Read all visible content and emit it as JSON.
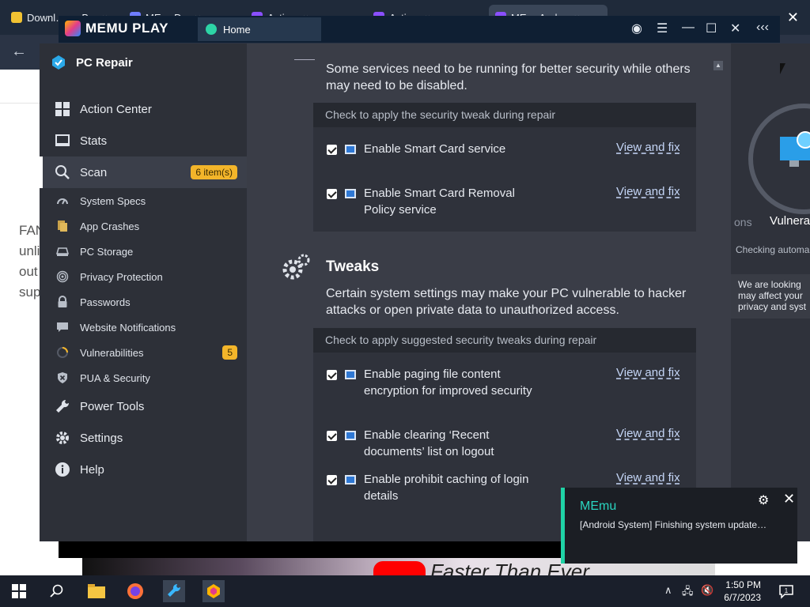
{
  "browser": {
    "tabs": [
      {
        "label": "Downl… — B… ×",
        "color": "#f1c232"
      },
      {
        "label": "ME… D… ×",
        "color": "#6f7dff"
      },
      {
        "label": "Activ… ×",
        "color": "#8a4fff"
      },
      {
        "label": "Activ… ×",
        "color": "#8a4fff"
      },
      {
        "label": "ME… Andr… ×",
        "color": "#8a4fff"
      }
    ],
    "page_lines": [
      "FAN",
      "unli",
      "out",
      "sup"
    ],
    "video_text": "Faster Than Ever"
  },
  "memu": {
    "title": "MEMU PLAY",
    "home_tab": "Home",
    "controls": [
      "person-icon",
      "menu-icon",
      "minimize-icon",
      "maximize-icon",
      "close-icon",
      "collapse-icon"
    ]
  },
  "app": {
    "name": "PC Repair",
    "nav": [
      {
        "label": "Action Center",
        "icon": "action-center-icon"
      },
      {
        "label": "Stats",
        "icon": "stats-icon"
      },
      {
        "label": "Scan",
        "icon": "scan-icon",
        "badge": "6 item(s)"
      }
    ],
    "sub": [
      {
        "label": "System Specs",
        "icon": "system-specs-icon"
      },
      {
        "label": "App Crashes",
        "icon": "app-crashes-icon"
      },
      {
        "label": "PC Storage",
        "icon": "pc-storage-icon"
      },
      {
        "label": "Privacy Protection",
        "icon": "privacy-icon"
      },
      {
        "label": "Passwords",
        "icon": "lock-icon"
      },
      {
        "label": "Website Notifications",
        "icon": "chat-icon"
      },
      {
        "label": "Vulnerabilities",
        "icon": "spinner-icon",
        "badge": "5"
      },
      {
        "label": "PUA & Security",
        "icon": "shield-x-icon"
      }
    ],
    "nav_bottom": [
      {
        "label": "Power Tools",
        "icon": "wrench-icon"
      },
      {
        "label": "Settings",
        "icon": "gear-icon"
      },
      {
        "label": "Help",
        "icon": "info-icon"
      }
    ],
    "services": {
      "intro": "Some services need to be running for better security while others may need to be disabled.",
      "panel_header": "Check to apply the security tweak during repair",
      "rows": [
        {
          "text": "Enable Smart Card service",
          "link": "View and fix"
        },
        {
          "text": "Enable Smart Card Removal Policy service",
          "link": "View and fix"
        }
      ]
    },
    "tweaks": {
      "title": "Tweaks",
      "intro": "Certain system settings may make your PC vulnerable to hacker attacks or open private data to unauthorized access.",
      "panel_header": "Check to apply suggested security tweaks during repair",
      "rows": [
        {
          "text": "Enable paging file content encryption for improved security",
          "link": "View and fix"
        },
        {
          "text": "Enable clearing ‘Recent documents’ list on logout",
          "link": "View and fix"
        },
        {
          "text": "Enable prohibit caching of login details",
          "link": "View and fix"
        }
      ]
    },
    "right": {
      "ons": "ons",
      "vulnerabilities": "Vulnera",
      "checking": "Checking automa",
      "looking": [
        "We are looking",
        "may affect your",
        "privacy and syst"
      ]
    }
  },
  "toast": {
    "title": "MEmu",
    "message": "[Android System] Finishing system update…",
    "accent": "#1fd3a6"
  },
  "taskbar": {
    "time": "1:50 PM",
    "date": "6/7/2023",
    "notification_count": "1"
  }
}
